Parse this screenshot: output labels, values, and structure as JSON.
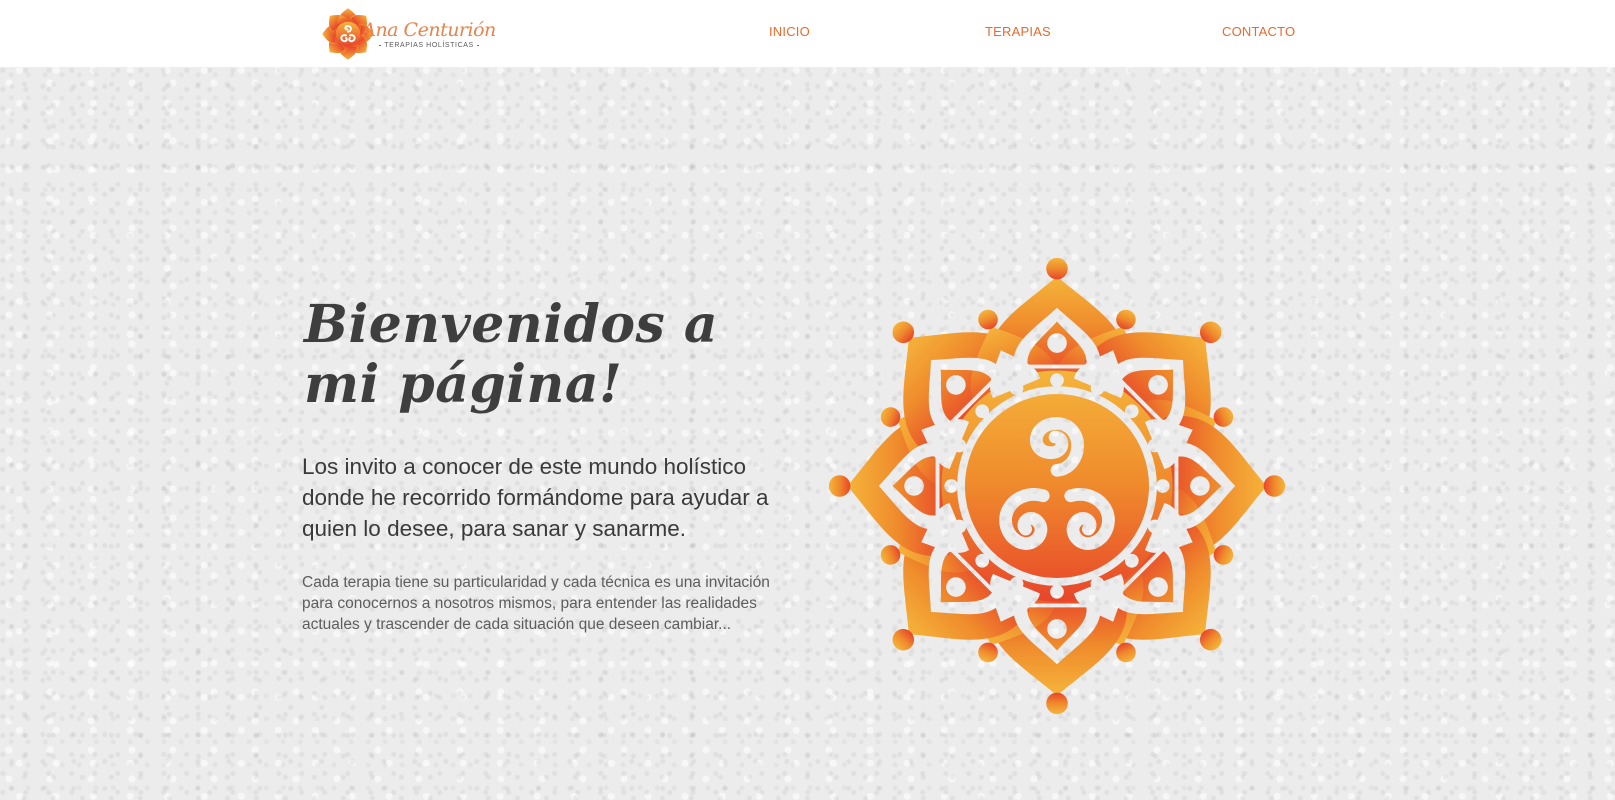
{
  "brand": {
    "name": "Ana Centurión",
    "tagline": "TERAPIAS HOLÍSTICAS",
    "logo_icon": "mandala-logo-icon"
  },
  "nav": {
    "items": [
      {
        "label": "INICIO"
      },
      {
        "label": "TERAPIAS"
      },
      {
        "label": "CONTACTO"
      }
    ]
  },
  "hero": {
    "title": "Bienvenidos a mi página!",
    "lead": "Los invito a conocer de este mundo holístico donde he recorrido formándome para ayudar a quien lo desee, para sanar y sanarme.",
    "body": "Cada terapia tiene su particularidad y cada técnica es una invitación para conocernos a nosotros mismos, para entender las realidades actuales y trascender de cada situación que deseen cambiar...",
    "image_icon": "mandala-icon"
  },
  "colors": {
    "accent": "#ea6a2c",
    "gradient_top": "#f5b43a",
    "gradient_bottom": "#e8452a",
    "heading": "#3e3e3e",
    "text": "#5d5d5d",
    "header_bg": "#ffffff",
    "page_bg": "#ececec"
  }
}
